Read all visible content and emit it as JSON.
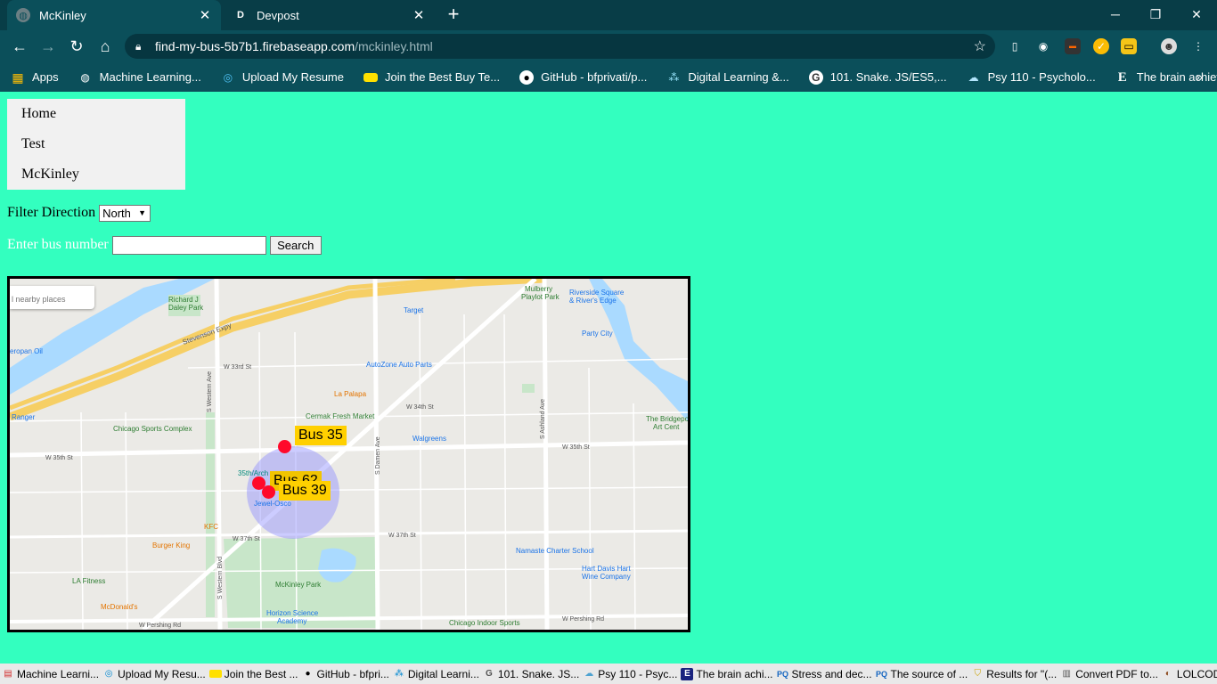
{
  "browser": {
    "tabs": [
      {
        "title": "McKinley",
        "favicon": "globe-icon",
        "active": true
      },
      {
        "title": "Devpost",
        "favicon_letter": "D",
        "active": false
      }
    ],
    "url_host": "find-my-bus-5b7b1.firebaseapp.com",
    "url_path": "/mckinley.html",
    "bookmarks": [
      {
        "label": "Apps",
        "icon": "apps-grid-icon"
      },
      {
        "label": "Machine Learning...",
        "icon": "globe-icon"
      },
      {
        "label": "Upload My Resume",
        "icon": "database-icon"
      },
      {
        "label": "Join the Best Buy Te...",
        "icon": "tag-icon"
      },
      {
        "label": "GitHub - bfprivati/p...",
        "icon": "github-icon"
      },
      {
        "label": "Digital Learning &...",
        "icon": "learning-icon"
      },
      {
        "label": "101. Snake. JS/ES5,...",
        "icon": "g-icon"
      },
      {
        "label": "Psy 110 - Psycholo...",
        "icon": "cloud-icon"
      },
      {
        "label": "The brain achieves i...",
        "icon": "e-icon"
      }
    ]
  },
  "nav": {
    "items": [
      {
        "label": "Home"
      },
      {
        "label": "Test"
      },
      {
        "label": "McKinley"
      }
    ]
  },
  "filter": {
    "label": "Filter Direction",
    "selected": "North"
  },
  "search": {
    "label": "Enter bus number",
    "value": "",
    "button": "Search"
  },
  "map": {
    "places_text": "l nearby places",
    "labels": {
      "richard_daley": "Richard J",
      "richard_daley2": "Daley Park",
      "target": "Target",
      "riverside": "Riverside Square",
      "riverside2": "& River's Edge",
      "mulberry": "Mulberry",
      "mulberry2": "Playlot Park",
      "party_city": "Party City",
      "stevenson": "Stevenson Expy",
      "european": "eropan Oil",
      "autozone": "AutoZone Auto Parts",
      "la_palapa": "La Palapa",
      "ranger": "Ranger",
      "chicago_sports": "Chicago Sports Complex",
      "cermak": "Cermak Fresh Market",
      "walgreens": "Walgreens",
      "bridgeport": "The Bridgepo",
      "bridgeport2": "Art Cent",
      "w35": "W 35th St",
      "w35b": "W 35th St",
      "archer": "35th/Arch",
      "jewel": "Jewel-Osco",
      "kfc": "KFC",
      "burger_king": "Burger King",
      "namaste": "Namaste Charter School",
      "hart_davis": "Hart Davis Hart",
      "hart_davis2": "Wine Company",
      "la_fitness": "LA Fitness",
      "mcdonalds": "McDonald's",
      "mckinley_park": "McKinley Park",
      "horizon": "Horizon Science",
      "horizon2": "Academy",
      "chicago_indoor": "Chicago Indoor Sports",
      "w_pershing": "W Pershing Rd",
      "w_pershing2": "W Pershing Rd",
      "s_western": "S Western Ave",
      "s_western_blvd": "S Western Blvd",
      "s_damen": "S Damen Ave",
      "s_ashland": "S Ashland Ave",
      "w37": "W 37th St",
      "w37b": "W 37th St",
      "w_34th": "W 34th St",
      "w_33rd": "W 33rd St"
    },
    "buses": [
      {
        "label": "Bus 35"
      },
      {
        "label": "Bus 62"
      },
      {
        "label": "Bus 39"
      }
    ]
  },
  "bottom_bar": [
    {
      "label": "Machine Learni...",
      "icon": "pdf-icon"
    },
    {
      "label": "Upload My Resu...",
      "icon": "database-icon"
    },
    {
      "label": "Join the Best ...",
      "icon": "tag-icon"
    },
    {
      "label": "GitHub - bfpri...",
      "icon": "github-icon"
    },
    {
      "label": "Digital Learni...",
      "icon": "learning-icon"
    },
    {
      "label": "101. Snake. JS...",
      "icon": "g-icon"
    },
    {
      "label": "Psy 110 - Psyc...",
      "icon": "cloud-icon"
    },
    {
      "label": "The brain achi...",
      "icon": "e-icon"
    },
    {
      "label": "Stress and dec...",
      "icon": "pq-icon"
    },
    {
      "label": "The source of ...",
      "icon": "pq-icon"
    },
    {
      "label": "Results for \"(...",
      "icon": "shield-icon"
    },
    {
      "label": "Convert PDF to...",
      "icon": "document-icon"
    },
    {
      "label": "LOLCODE",
      "icon": "cat-icon"
    }
  ],
  "colors": {
    "page_bg": "#33ffbf",
    "bus_label_bg": "#ffd000",
    "bus_dot": "#ff0a2a",
    "chrome_bg": "#0b4f5a"
  }
}
